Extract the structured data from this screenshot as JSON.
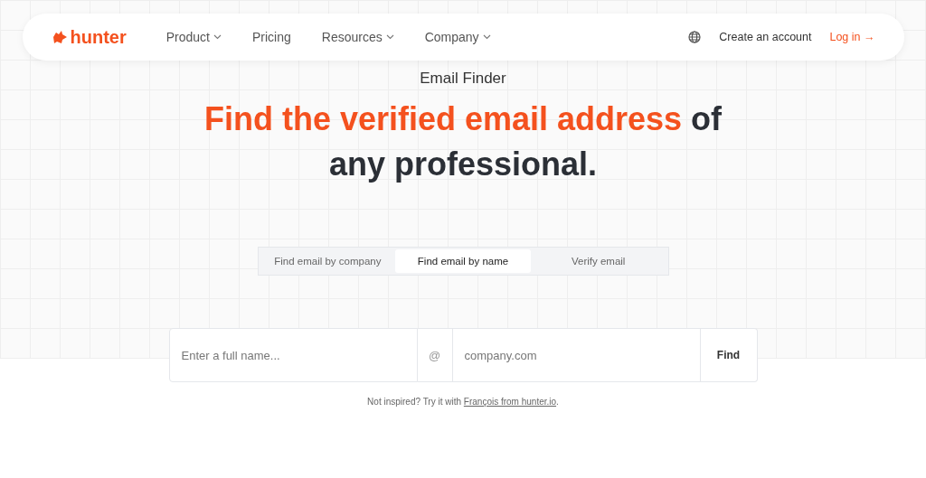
{
  "nav": {
    "logo": "hunter",
    "links": [
      {
        "label": "Product",
        "dropdown": true
      },
      {
        "label": "Pricing",
        "dropdown": false
      },
      {
        "label": "Resources",
        "dropdown": true
      },
      {
        "label": "Company",
        "dropdown": true
      }
    ],
    "create_account": "Create an account",
    "login": "Log in →"
  },
  "eyebrow": "Email Finder",
  "headline": {
    "highlight": "Find the verified email address",
    "rest": "of",
    "line2": "any professional."
  },
  "tabs": [
    {
      "label": "Find email by company",
      "selected": false
    },
    {
      "label": "Find email by name",
      "selected": true
    },
    {
      "label": "Verify email",
      "selected": false
    }
  ],
  "form": {
    "name_placeholder": "Enter a full name...",
    "at": "@",
    "domain_placeholder": "company.com",
    "button": "Find"
  },
  "hint": {
    "before": "Not inspired? Try it with",
    "link": "François from hunter.io",
    "after": "."
  }
}
